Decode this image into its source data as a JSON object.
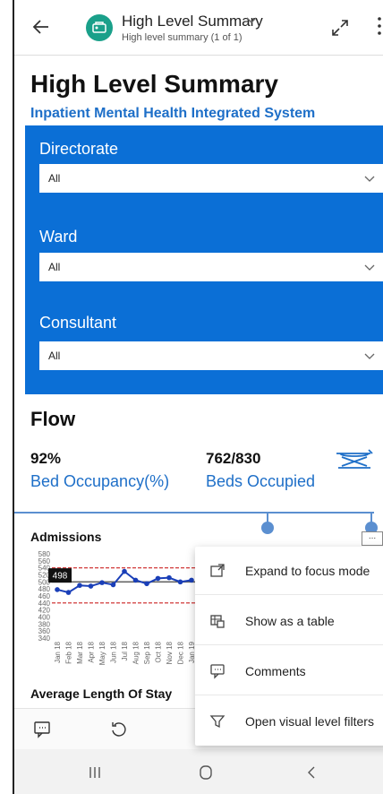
{
  "appbar": {
    "title": "High Level Summary",
    "subtitle": "High level summary (1 of 1)"
  },
  "page": {
    "title": "High Level Summary",
    "subtitle": "Inpatient Mental Health Integrated System"
  },
  "filters": [
    {
      "label": "Directorate",
      "value": "All"
    },
    {
      "label": "Ward",
      "value": "All"
    },
    {
      "label": "Consultant",
      "value": "All"
    }
  ],
  "flow": {
    "title": "Flow",
    "kpis": [
      {
        "value": "92%",
        "label": "Bed Occupancy(%)"
      },
      {
        "value": "762/830",
        "label": "Beds Occupied"
      }
    ]
  },
  "admissions": {
    "title": "Admissions",
    "more_label": "...",
    "tooltip": "498"
  },
  "chart_data": {
    "type": "line",
    "title": "Admissions",
    "y_ticks": [
      580,
      560,
      540,
      520,
      500,
      480,
      460,
      440,
      420,
      400,
      380,
      360,
      340
    ],
    "ylim": [
      340,
      580
    ],
    "x": [
      "Jan 18",
      "Feb 18",
      "Mar 18",
      "Apr 18",
      "May 18",
      "Jun 18",
      "Jul 18",
      "Aug 18",
      "Sep 18",
      "Oct 18",
      "Nov 18",
      "Dec 18",
      "Jan 19"
    ],
    "series": [
      {
        "values": [
          478,
          470,
          490,
          488,
          498,
          492,
          530,
          505,
          495,
          510,
          512,
          500,
          505
        ]
      }
    ],
    "reference_lines": {
      "mean": 500,
      "upper": 540,
      "lower": 440
    },
    "colors": {
      "series": "#1a3fb8",
      "mean": "#666666",
      "limits": "#cc2222"
    }
  },
  "als": {
    "title": "Average Length Of Stay"
  },
  "menu": {
    "items": [
      {
        "label": "Expand to focus mode",
        "icon": "focus-mode-icon"
      },
      {
        "label": "Show as a table",
        "icon": "table-icon"
      },
      {
        "label": "Comments",
        "icon": "comment-icon"
      },
      {
        "label": "Open visual level filters",
        "icon": "filter-icon"
      }
    ]
  },
  "colors": {
    "accent": "#1e6fc8",
    "filter_bg": "#0b6fd6",
    "report_icon": "#1aa08a",
    "callout": "#5b8fd0"
  }
}
